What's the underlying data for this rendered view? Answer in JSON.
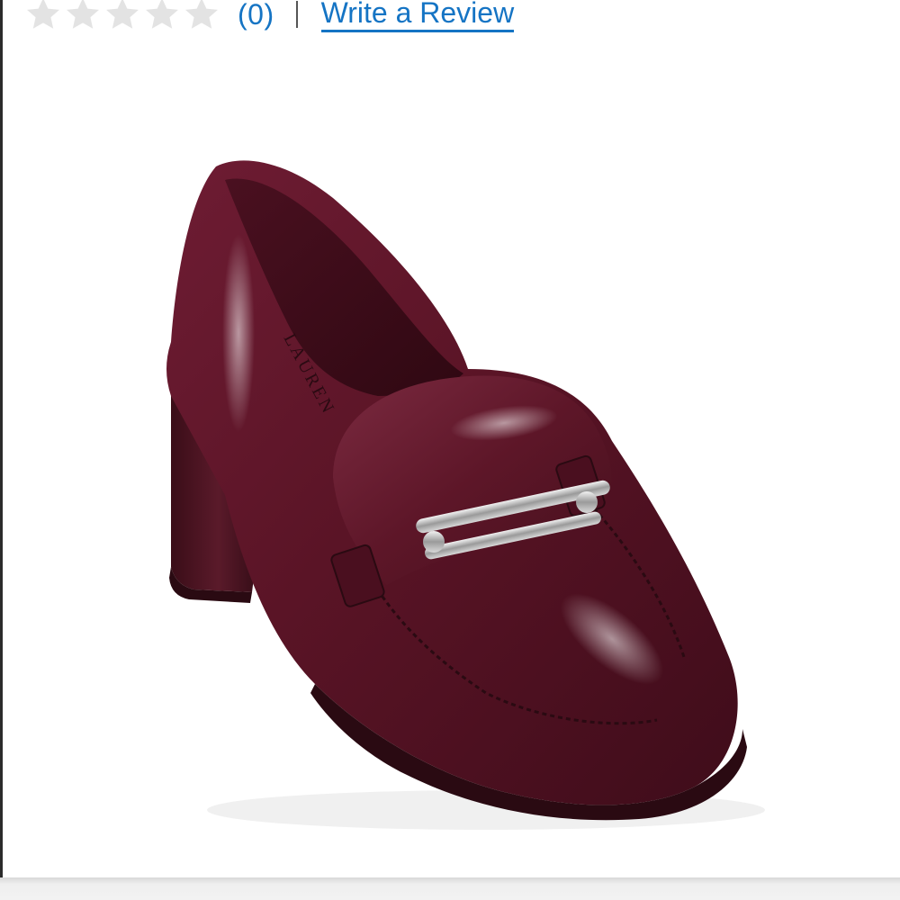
{
  "rating": {
    "stars_filled": 0,
    "stars_total": 5,
    "count_label": "(0)",
    "separator": "|",
    "write_review_label": "Write a Review"
  },
  "product": {
    "image_icon": "burgundy-patent-loafer-pump",
    "insole_brand": "LAUREN"
  },
  "colors": {
    "link": "#1574c4",
    "star_empty": "#e3e3e3",
    "product": "#5a1426"
  }
}
